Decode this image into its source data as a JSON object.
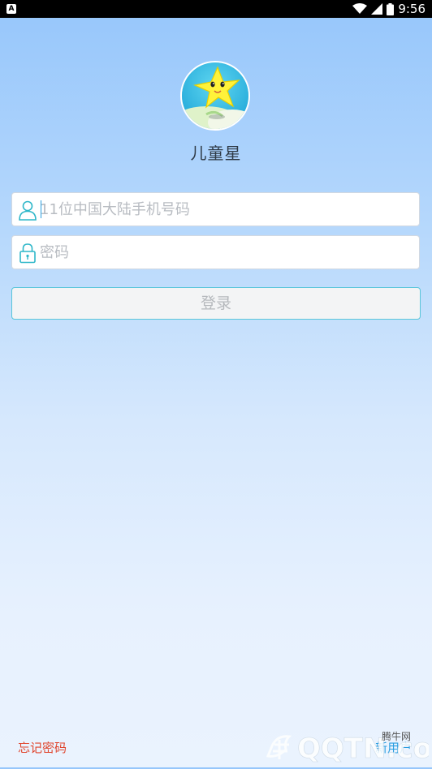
{
  "status_bar": {
    "app_icon_letter": "A",
    "time": "9:56",
    "icons": [
      "wifi-icon",
      "signal-icon",
      "battery-icon"
    ]
  },
  "app": {
    "name": "儿童星"
  },
  "login_form": {
    "phone_placeholder": "11位中国大陆手机号码",
    "password_placeholder": "密码",
    "login_label": "登录"
  },
  "footer": {
    "forgot_password": "忘记密码",
    "new_user": "新用户"
  },
  "watermark": {
    "text": "腾牛网",
    "domain": "QQTN.com"
  },
  "colors": {
    "accent_teal": "#2fb7c9",
    "forgot_red": "#e0462e",
    "link_blue": "#2a9ee0"
  }
}
